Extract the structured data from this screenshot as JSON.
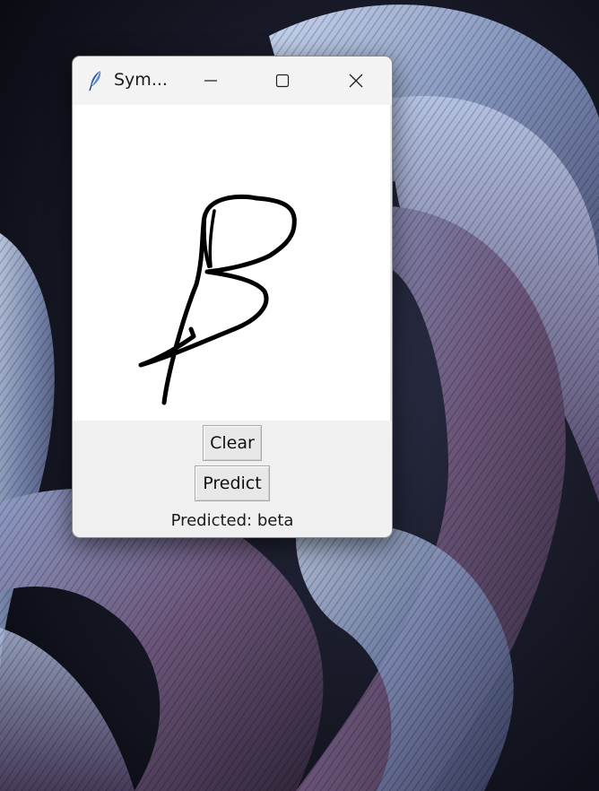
{
  "window": {
    "title": "Sym...",
    "minimize_icon": "minimize-icon",
    "maximize_icon": "maximize-icon",
    "close_icon": "close-icon",
    "app_icon": "feather-icon"
  },
  "canvas": {
    "drawn_symbol": "handwritten beta stroke",
    "background": "#ffffff",
    "stroke_color": "#000000"
  },
  "controls": {
    "clear_label": "Clear",
    "predict_label": "Predict"
  },
  "status": {
    "prediction_text": "Predicted: beta"
  }
}
